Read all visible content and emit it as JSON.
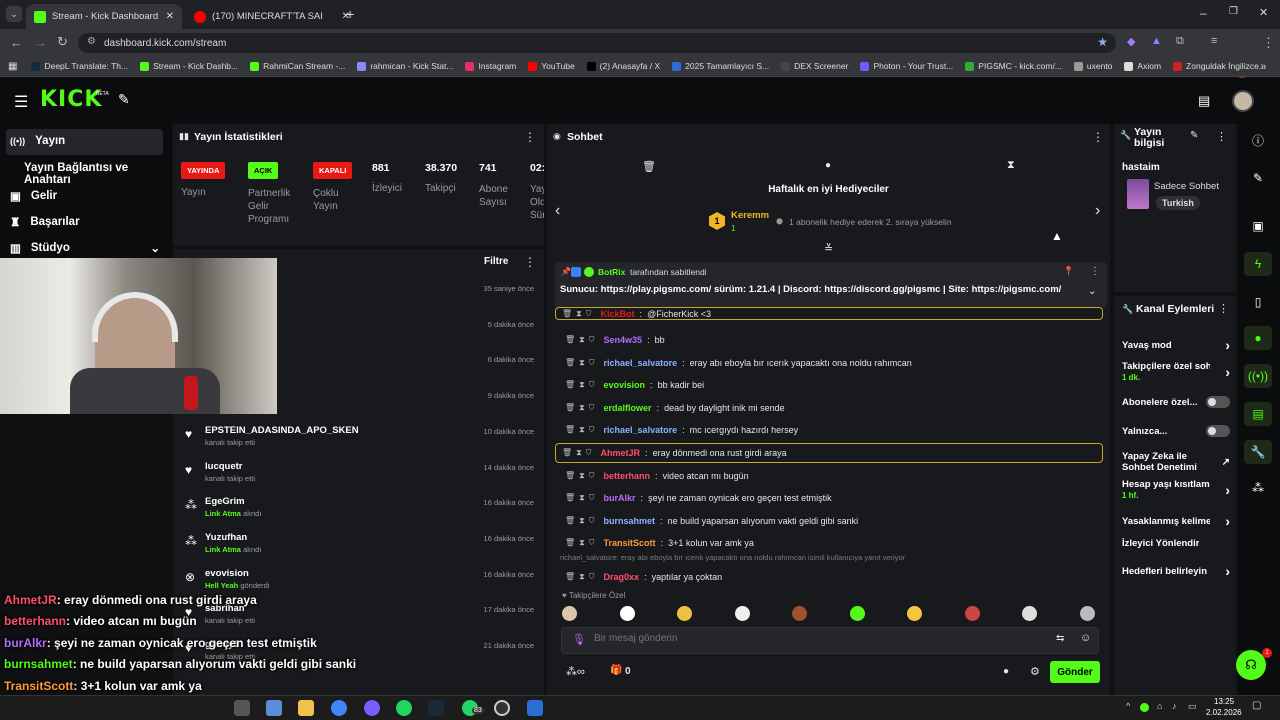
{
  "browser": {
    "tabs": [
      {
        "title": "Stream - Kick Dashboard"
      },
      {
        "title": "(170) MINECRAFT'TA SAKLAMB..."
      }
    ],
    "url": "dashboard.kick.com/stream",
    "bookmarks": [
      "DeepL Translate: Th...",
      "Stream - Kick Dashb...",
      "RahmiCan Stream -...",
      "rahmican - Kick Stat...",
      "Instagram",
      "YouTube",
      "(2) Anasayfa / X",
      "2025 Tamamlayıcı S...",
      "DEX Screener",
      "Photon - Your Trust...",
      "PIGSMC - kick.com/...",
      "uxento",
      "Axiom",
      "Zonguldak İngilizce..."
    ]
  },
  "header": {
    "logo": "KICK",
    "logo_sup": "BETA"
  },
  "sidebar": {
    "items": [
      {
        "label": "Yayın",
        "icon": "broadcast-icon"
      },
      {
        "label": "Yayın Bağlantısı ve Anahtarı"
      },
      {
        "label": "Gelir",
        "icon": "wallet-icon"
      },
      {
        "label": "Başarılar",
        "icon": "trophy-icon"
      },
      {
        "label": "Stüdyo",
        "icon": "studio-icon"
      }
    ]
  },
  "stats": {
    "title": "Yayın İstatistikleri",
    "badges": [
      {
        "text": "YAYINDA",
        "label": "Yayın",
        "color": "#e91916"
      },
      {
        "text": "AÇIK",
        "label": "Partnerlik Gelir Programı",
        "color": "#53fc18"
      },
      {
        "text": "KAPALI",
        "label": "Çoklu Yayın",
        "color": "#e91916"
      }
    ],
    "numbers": [
      {
        "value": "881",
        "label": "İzleyici"
      },
      {
        "value": "38.370",
        "label": "Takipçi"
      },
      {
        "value": "741",
        "label": "Abone Sayısı"
      },
      {
        "value": "02:",
        "label": "Yay Old Sür"
      }
    ]
  },
  "activity": {
    "filter": "Filtre",
    "items": [
      {
        "name": "",
        "sub": "",
        "time": "35 saniye önce"
      },
      {
        "name": "",
        "sub": "",
        "time": "5 dakika önce"
      },
      {
        "name": "",
        "sub": "",
        "time": "6 dakika önce"
      },
      {
        "name": "",
        "sub": "",
        "time": "9 dakika önce"
      },
      {
        "name": "EPSTEIN_ADASINDA_APO_SKEN",
        "sub": "kanalı takip etti",
        "time": "10 dakika önce",
        "icon": "heart-icon"
      },
      {
        "name": "lucquetr",
        "sub": "kanalı takip etti",
        "time": "14 dakika önce",
        "icon": "heart-icon"
      },
      {
        "name": "EgeGrim",
        "sub_green": "Link Atma",
        "sub": "alındı",
        "time": "16 dakika önce",
        "icon": "reward-icon"
      },
      {
        "name": "Yuzufhan",
        "sub_green": "Link Atma",
        "sub": "alındı",
        "time": "16 dakika önce",
        "icon": "reward-icon"
      },
      {
        "name": "evovision",
        "sub_green": "Hell Yeah",
        "sub": "gönderdi",
        "time": "16 dakika önce",
        "icon": "x-icon"
      },
      {
        "name": "sabrihan",
        "sub": "kanalı takip etti",
        "time": "17 dakika önce",
        "icon": "heart-icon"
      },
      {
        "name": "gundy1",
        "sub": "kanalı takip etti",
        "time": "21 dakika önce",
        "icon": "heart-icon"
      }
    ]
  },
  "chat": {
    "title": "Sohbet",
    "gifters_title": "Haftalık en iyi Hediyeciler",
    "top_gifter": "Keremm",
    "top_gifter_count": "1",
    "gifter_hint": "1 abonelik hediye ederek 2. sıraya yükselin",
    "pinned_by": "BotRix",
    "pinned_suffix": "tarafından sabitlendi",
    "pinned_text": "Sunucu: https://play.pigsmc.com/ sürüm: 1.21.4 | Discord: https://discord.gg/pigsmc | Site: https://pigsmc.com/",
    "messages": [
      {
        "user": "KickBot",
        "color": "#e91916",
        "text": "@FicherKick <3",
        "highlight": true
      },
      {
        "user": "Sen4w35",
        "color": "#b56cff",
        "text": "bb"
      },
      {
        "user": "richael_salvatore",
        "color": "#8ab4ff",
        "text": "eray abı eboyla bır ıcerık yapacaktı ona noldu rahımcan"
      },
      {
        "user": "evovision",
        "color": "#53fc18",
        "text": "bb kadir bei"
      },
      {
        "user": "erdalflower",
        "color": "#53fc18",
        "text": "dead by daylight inik mi sende"
      },
      {
        "user": "richael_salvatore",
        "color": "#8ab4ff",
        "text": "mc ıcergıydı hazırdı hersey"
      },
      {
        "user": "AhmetJR",
        "color": "#ff4f6b",
        "text": "eray dönmedi ona rust girdi araya",
        "highlight": true
      },
      {
        "user": "betterhann",
        "color": "#ff4f6b",
        "text": "video atcan mı bugün"
      },
      {
        "user": "burAlkr",
        "color": "#b56cff",
        "text": "şeyi ne zaman oynicak ero geçen test etmiştik"
      },
      {
        "user": "burnsahmet",
        "color": "#8ab4ff",
        "text": "ne build yaparsan alıyorum vakti geldi gibi sanki"
      },
      {
        "user": "TransitScott",
        "color": "#ff9a3c",
        "text": "3+1 kolun var amk ya"
      },
      {
        "user": "Drag0xx",
        "color": "#ff4f6b",
        "text": "yaptılar ya çoktan"
      }
    ],
    "reply_hint": "richael_salvatore: eray abı eboyla bır ıcerık yapacaktı ona noldu rahımcan isimli kullanıcıya yanıt veriyor",
    "emote_label": "Takipçilere Özel",
    "input_placeholder": "Bir mesaj gönderin",
    "send_label": "Gönder",
    "bottom_count": "0"
  },
  "stream_info": {
    "title": "Yayın bilgisi",
    "stream_title": "hastaim",
    "category": "Sadece Sohbet",
    "language": "Turkish"
  },
  "channel_actions": {
    "title": "Kanal Eylemleri",
    "items": [
      {
        "label": "Yavaş mod",
        "type": "chevron"
      },
      {
        "label": "Takipçilere özel soh",
        "sub": "1 dk.",
        "type": "chevron"
      },
      {
        "label": "Abonelere özel...",
        "type": "toggle"
      },
      {
        "label": "Yalnızca...",
        "type": "toggle"
      },
      {
        "label": "Yapay Zeka ile Sohbet Denetimi",
        "type": "external"
      },
      {
        "label": "Hesap yaşı kısıtlama",
        "sub": "1 hf.",
        "type": "chevron"
      },
      {
        "label": "Yasaklanmış kelimel",
        "type": "chevron"
      },
      {
        "label": "İzleyici Yönlendir",
        "type": "none"
      },
      {
        "label": "Hedefleri belirleyin",
        "type": "chevron"
      }
    ]
  },
  "overlay_chat": [
    {
      "user": "AhmetJR",
      "color": "#ff4f6b",
      "text": ": eray dönmedi ona rust girdi araya"
    },
    {
      "user": "betterhann",
      "color": "#ff4f6b",
      "text": ": video atcan mı bugün"
    },
    {
      "user": "burAlkr",
      "color": "#b56cff",
      "text": ": şeyi ne zaman oynicak ero geçen test etmiştik"
    },
    {
      "user": "burnsahmet",
      "color": "#53fc18",
      "text": ": ne build yaparsan alıyorum vakti geldi gibi sanki"
    },
    {
      "user": "TransitScott",
      "color": "#ff9a3c",
      "text": ": 3+1 kolun var amk ya"
    },
    {
      "user": "Drag0xx",
      "color": "#ff4f6b",
      "text": ": yaptılar ya çoktan"
    }
  ],
  "taskbar": {
    "time": "13:25",
    "date": "2.02.2026",
    "whatsapp_badge": "83"
  },
  "colors": {
    "accent": "#53fc18",
    "live": "#e91916"
  }
}
